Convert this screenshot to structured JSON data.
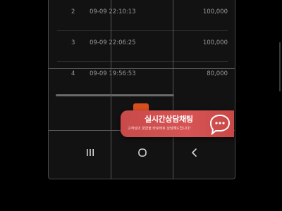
{
  "table": {
    "rows": [
      {
        "no": "2",
        "time": "09-09 22:10:13",
        "amount": "100,000"
      },
      {
        "no": "3",
        "time": "09-09 22:06:25",
        "amount": "100,000"
      },
      {
        "no": "4",
        "time": "09-09 19:56:53",
        "amount": "80,000"
      }
    ]
  },
  "chat_banner": {
    "title": "실시간상담채팅",
    "subtitle": "고객님의 궁금을 바로바로 상담해드립니다!",
    "icon": "chat-bubble-icon",
    "color": "#d65454"
  },
  "nav": {
    "recent_icon": "recent-apps-icon",
    "home_icon": "home-icon",
    "back_icon": "back-icon"
  },
  "colors": {
    "accent": "#d94e1f",
    "background": "#121212"
  }
}
